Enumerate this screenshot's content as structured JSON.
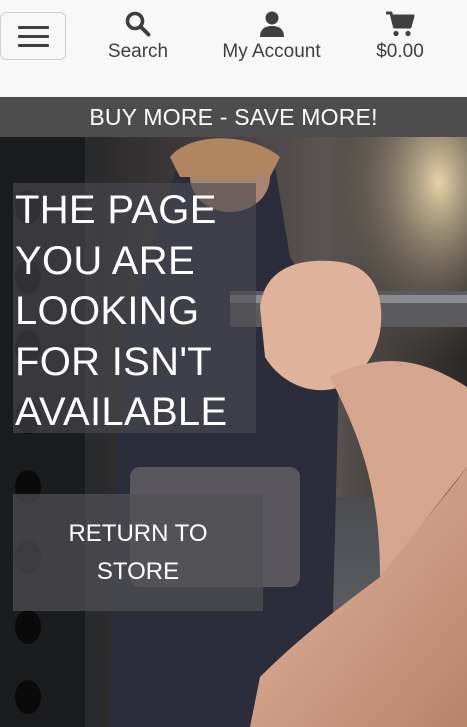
{
  "header": {
    "menu_icon": "hamburger-menu-icon",
    "search": {
      "label": "Search",
      "icon": "search-icon"
    },
    "account": {
      "label": "My Account",
      "icon": "user-icon"
    },
    "cart": {
      "label": "$0.00",
      "icon": "shopping-cart-icon"
    }
  },
  "promo": {
    "text": "BUY MORE - SAVE MORE!"
  },
  "hero": {
    "heading": "THE PAGE YOU ARE LOOKING FOR ISN'T AVAILABLE",
    "return_label": "RETURN TO STORE",
    "background_subject": "person gripping a barbell in a gym"
  },
  "colors": {
    "header_bg": "#f8f8f8",
    "promo_bg": "#4d4d4d",
    "icon": "#3f3f3f",
    "text_light": "#ffffff"
  }
}
